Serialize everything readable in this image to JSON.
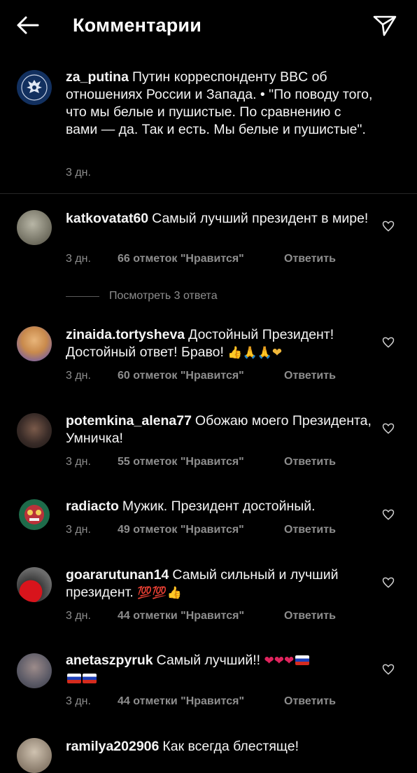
{
  "header": {
    "title": "Комментарии",
    "back_icon": "arrow-left-icon",
    "send_icon": "paper-plane-icon"
  },
  "caption": {
    "username": "za_putina",
    "text": "Путин корреспонденту BBC об отношениях России и Запада. • \"По поводу того, что мы белые и пушистые. По сравнению с вами — да. Так и есть. Мы белые и пушистые\".",
    "time": "3 дн."
  },
  "view_replies_label": "Посмотреть 3 ответа",
  "reply_label": "Ответить",
  "comments": [
    {
      "username": "katkovatat60",
      "text": "Самый лучший президент в мире!",
      "time": "3 дн.",
      "likes": "66 отметок \"Нравится\""
    },
    {
      "username": "zinaida.tortysheva",
      "text": "Достойный Президент! Достойный ответ! Браво!",
      "emoji": "👍🙏🙏❤",
      "time": "3 дн.",
      "likes": "60 отметок \"Нравится\""
    },
    {
      "username": "potemkina_alena77",
      "text": "Обожаю моего Президента, Умничка!",
      "time": "3 дн.",
      "likes": "55 отметок \"Нравится\""
    },
    {
      "username": "radiacto",
      "text": "Мужик. Президент достойный.",
      "time": "3 дн.",
      "likes": "49 отметок \"Нравится\""
    },
    {
      "username": "goararutunan14",
      "text": "Самый сильный и лучший президент.",
      "emoji": "💯💯👍",
      "time": "3 дн.",
      "likes": "44 отметки \"Нравится\""
    },
    {
      "username": "anetaszpyruk",
      "text": "Самый лучший!!",
      "emoji": "❤❤❤",
      "time": "3 дн.",
      "likes": "44 отметки \"Нравится\""
    },
    {
      "username": "ramilya202906",
      "text": "Как всегда блестяще!"
    }
  ],
  "colors": {
    "background": "#000000",
    "text": "#f5f5f5",
    "secondary": "#8e8e8e",
    "divider": "#262626",
    "emoji_red": "#e0245e"
  }
}
